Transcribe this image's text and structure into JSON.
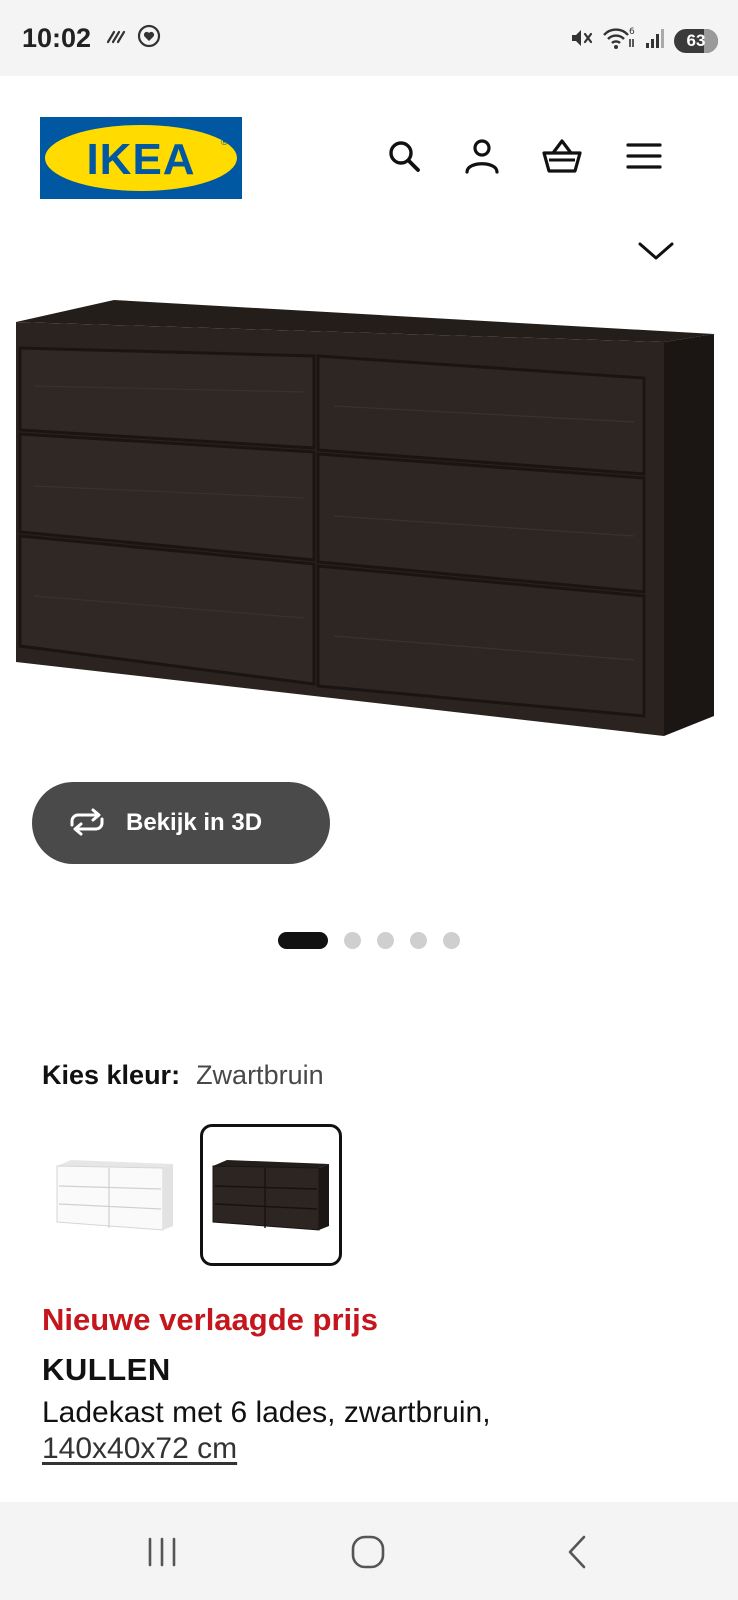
{
  "status_bar": {
    "time": "10:02",
    "battery": "63",
    "icons": [
      "data-saver-icon",
      "heart-circle-icon",
      "mute-icon",
      "wifi-icon",
      "signal-icon",
      "battery-icon"
    ]
  },
  "header": {
    "logo_text": "IKEA",
    "icons": [
      "search-icon",
      "account-icon",
      "cart-icon",
      "menu-icon"
    ]
  },
  "product_media": {
    "chevron_icon": "chevron-down-icon",
    "view_3d_label": "Bekijk in 3D",
    "view_3d_icon": "rotate-icon",
    "carousel_count": 5,
    "carousel_active_index": 0
  },
  "color_picker": {
    "label": "Kies kleur:",
    "selected_value": "Zwartbruin",
    "options": [
      "white",
      "zwartbruin"
    ],
    "selected_index": 1
  },
  "product": {
    "promo": "Nieuwe verlaagde prijs",
    "name": "KULLEN",
    "description": "Ladekast met 6 lades, zwartbruin,",
    "dimensions": "140x40x72 cm"
  },
  "colors": {
    "brand_blue": "#0058a3",
    "brand_yellow": "#ffdb00",
    "promo_red": "#c4161c",
    "button_dark": "#4a4a4a",
    "dresser_brown": "#2c2521"
  },
  "nav_bar": {
    "icons": [
      "recent-apps-icon",
      "home-icon",
      "back-icon"
    ]
  }
}
